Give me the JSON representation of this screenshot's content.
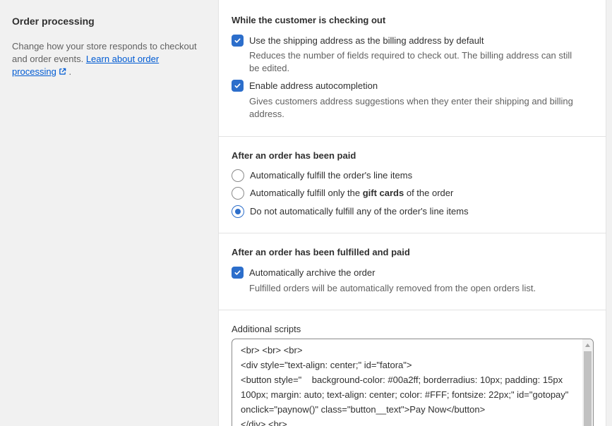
{
  "section": {
    "title": "Order processing",
    "description": "Change how your store responds to checkout and order events.",
    "link_text_1": "Learn about order",
    "link_text_2": "processing",
    "trailing": "."
  },
  "checkout": {
    "heading": "While the customer is checking out",
    "option1_label": "Use the shipping address as the billing address by default",
    "option1_help": "Reduces the number of fields required to check out. The billing address can still be edited.",
    "option1_checked": true,
    "option2_label": "Enable address autocompletion",
    "option2_help": "Gives customers address suggestions when they enter their shipping and billing address.",
    "option2_checked": true
  },
  "paid": {
    "heading": "After an order has been paid",
    "radio1_label": "Automatically fulfill the order's line items",
    "radio2_before": "Automatically fulfill only the",
    "radio2_bold": "gift cards",
    "radio2_after": "of the order",
    "radio3_label": "Do not automatically fulfill any of the order's line items",
    "selected": 3
  },
  "fulfilled": {
    "heading": "After an order has been fulfilled and paid",
    "option_label": "Automatically archive the order",
    "option_help": "Fulfilled orders will be automatically removed from the open orders list.",
    "option_checked": true
  },
  "scripts": {
    "label": "Additional scripts",
    "line1": "<br> <br> <br>",
    "line2": "<div style=\"text-align: center;\" id=\"fatora\">",
    "line3": "<button style=\"    background-color: #00a2ff; borderradius: 10px; padding: 15px 100px; margin: auto; text-align: center; color: #FFF; fontsize: 22px;\" id=\"gotopay\" onclick=\"paynow()\" class=\"button__text\">Pay Now</button>",
    "line4": "</div> <br>"
  },
  "colors": {
    "accent": "#2c6ecb",
    "link": "#005bd3"
  }
}
